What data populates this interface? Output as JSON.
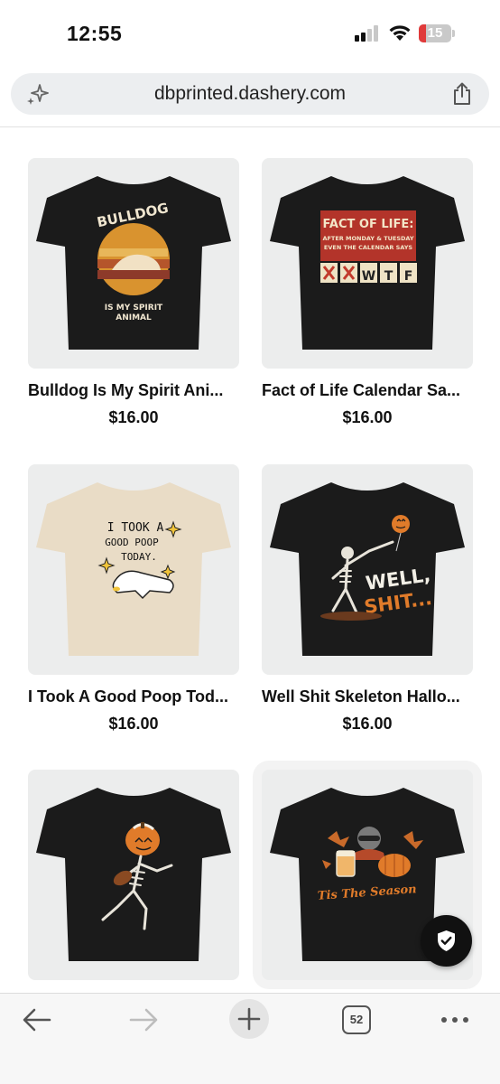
{
  "status_bar": {
    "time": "12:55",
    "battery_level": "15"
  },
  "address_bar": {
    "url": "dbprinted.dashery.com"
  },
  "products": [
    {
      "title": "Bulldog Is My Spirit Ani...",
      "price": "$16.00",
      "shirt_color": "#1b1b1b",
      "design_text": [
        "BULLDOG",
        "IS MY SPIRIT",
        "ANIMAL"
      ]
    },
    {
      "title": "Fact of Life Calendar Sa...",
      "price": "$16.00",
      "shirt_color": "#1b1b1b",
      "design_text": [
        "FACT OF LIFE:",
        "AFTER MONDAY & TUESDAY",
        "EVEN THE CALENDAR SAYS",
        "W",
        "T",
        "F"
      ]
    },
    {
      "title": "I Took A Good Poop Tod...",
      "price": "$16.00",
      "shirt_color": "#e9dcc6",
      "design_text": [
        "I TOOK A",
        "GOOD POOP",
        "TODAY."
      ]
    },
    {
      "title": "Well Shit Skeleton Hallo...",
      "price": "$16.00",
      "shirt_color": "#1b1b1b",
      "design_text": [
        "WELL,",
        "SHIT..."
      ]
    },
    {
      "title": "",
      "price": "",
      "shirt_color": "#1b1b1b",
      "design_text": []
    },
    {
      "title": "",
      "price": "",
      "shirt_color": "#1b1b1b",
      "design_text": [
        "Tis The Season"
      ]
    }
  ],
  "toolbar": {
    "tab_count": "52"
  },
  "icons": {
    "sparkle": "sparkle-icon",
    "share": "share-icon",
    "back": "back-arrow-icon",
    "forward": "forward-arrow-icon",
    "new_tab": "plus-icon",
    "more": "more-dots-icon",
    "shield": "shield-check-icon"
  },
  "colors": {
    "accent_orange": "#e07b2a",
    "battery_low": "#e03a3a",
    "card_bg": "#eceded"
  }
}
